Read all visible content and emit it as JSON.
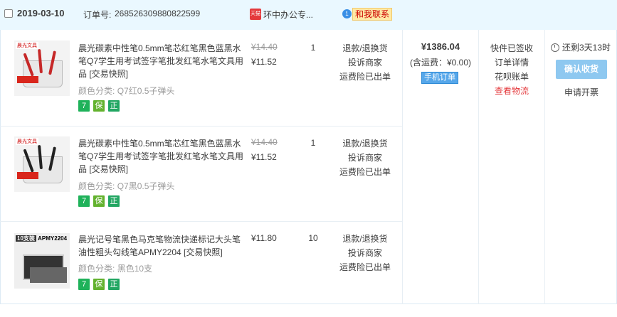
{
  "header": {
    "date": "2019-03-10",
    "order_label": "订单号:",
    "order_no": "268526309880822599",
    "shop_icon_text": "天猫",
    "shop_name": "环中办公专...",
    "contact_badge": "1",
    "contact_label": "和我联系"
  },
  "items": [
    {
      "title": "晨光碳素中性笔0.5mm笔芯红笔黑色蓝黑水笔Q7学生用考试签字笔批发红笔水笔文具用品 [交易快照]",
      "sku_label": "颜色分类:",
      "sku_value": "Q7红0.5子弹头",
      "price_original": "¥14.40",
      "price": "¥11.52",
      "qty": "1",
      "after_sales": [
        "退款/退换货",
        "投诉商家",
        "运费险已出单"
      ],
      "thumb": {
        "brand": "晨光文具",
        "pen_color": "#c62828"
      }
    },
    {
      "title": "晨光碳素中性笔0.5mm笔芯红笔黑色蓝黑水笔Q7学生用考试签字笔批发红笔水笔文具用品 [交易快照]",
      "sku_label": "颜色分类:",
      "sku_value": "Q7黑0.5子弹头",
      "price_original": "¥14.40",
      "price": "¥11.52",
      "qty": "1",
      "after_sales": [
        "退款/退换货",
        "投诉商家",
        "运费险已出单"
      ],
      "thumb": {
        "brand": "晨光文具",
        "pen_color": "#222222"
      }
    },
    {
      "title": "晨光记号笔黑色马克笔物流快递标记大头笔油性粗头勾线笔APMY2204 [交易快照]",
      "sku_label": "颜色分类:",
      "sku_value": "黑色10支",
      "price_original": "",
      "price": "¥11.80",
      "qty": "10",
      "after_sales": [
        "退款/退换货",
        "投诉商家",
        "运费险已出单"
      ],
      "thumb": {
        "tag": "10支装",
        "model": "APMY2204"
      }
    }
  ],
  "badges": {
    "seven_icon": "7",
    "shield_icon": "保",
    "zheng_icon": "正"
  },
  "summary": {
    "total": "¥1386.04",
    "shipping": "(含运费：¥0.00)",
    "mobile_tag": "手机订单"
  },
  "status": {
    "state": "快件已签收",
    "detail": "订单详情",
    "huabei": "花呗账单",
    "logistics": "查看物流"
  },
  "actions": {
    "countdown": "还剩3天13时",
    "confirm": "确认收货",
    "invoice": "申请开票"
  },
  "colors": {
    "header_bg": "#eaf8ff",
    "link_red": "#e4393c",
    "confirm_bg": "#8ec8f0"
  }
}
